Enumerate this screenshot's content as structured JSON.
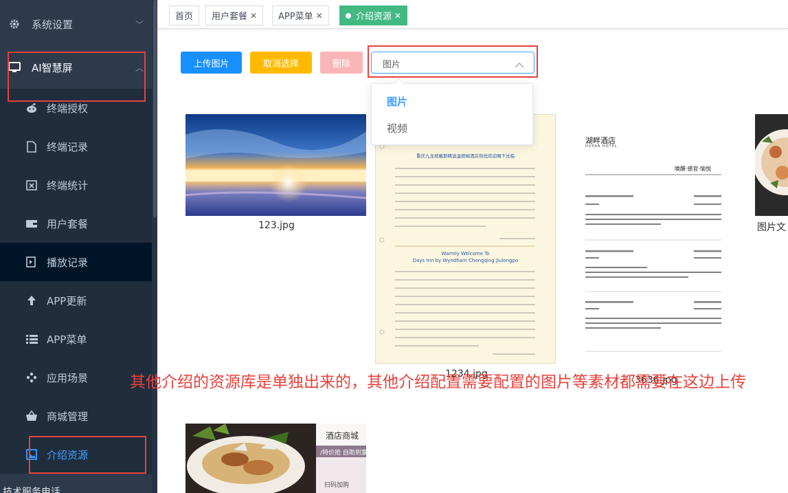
{
  "sidebar": {
    "items": [
      {
        "label": "系统设置",
        "icon": "gear-icon"
      },
      {
        "label": "AI智慧屏",
        "icon": "monitor-icon"
      },
      {
        "label": "终端授权",
        "icon": "robot-icon"
      },
      {
        "label": "终端记录",
        "icon": "document-icon"
      },
      {
        "label": "终端统计",
        "icon": "calendar-icon"
      },
      {
        "label": "用户套餐",
        "icon": "wallet-icon"
      },
      {
        "label": "播放记录",
        "icon": "video-record-icon"
      },
      {
        "label": "APP更新",
        "icon": "arrow-up-icon"
      },
      {
        "label": "APP菜单",
        "icon": "list-icon"
      },
      {
        "label": "应用场景",
        "icon": "pinwheel-icon"
      },
      {
        "label": "商城管理",
        "icon": "basket-icon"
      },
      {
        "label": "介绍资源",
        "icon": "picture-icon"
      }
    ],
    "bottom_label": "技术服务电话"
  },
  "tags": [
    {
      "label": "首页"
    },
    {
      "label": "用户套餐"
    },
    {
      "label": "APP菜单"
    },
    {
      "label": "介绍资源"
    }
  ],
  "toolbar": {
    "upload_label": "上传图片",
    "cancel_label": "取消选择",
    "delete_label": "删除",
    "type_select_value": "图片",
    "type_options": [
      "图片",
      "视频"
    ]
  },
  "gallery": [
    {
      "file": "123.jpg"
    },
    {
      "file": "1234.jpg"
    },
    {
      "file": "3636.jpg"
    },
    {
      "file": "图片文"
    },
    {
      "file": ""
    }
  ],
  "thumb_text": {
    "hotel_name": "湖畔酒店",
    "hotel_sub": "HUPAN HOTEL",
    "hotel_slogan": "唤醒·感官·愉悦",
    "letter_title": "重庆九龙坡戴斯精选温德姆酒店热忱欢迎阁下光临",
    "letter_en_1": "Warmly Welcome To",
    "letter_en_2": "Days Inn by Wyndham Chongqing Jiulongpo",
    "mall_title": "酒店商城",
    "mall_sub": "/特价抢 自助到家/",
    "mall_scan": "扫码加购"
  },
  "annotation": "其他介绍的资源库是单独出来的，其他介绍配置需要配置的图片等素材都需要在这边上传",
  "colors": {
    "sidebar_bg": "#2d3a4b",
    "active_text": "#409eff",
    "tag_active": "#42b983",
    "primary": "#1890ff",
    "warning": "#ffba00",
    "danger_disabled": "#fab6b6",
    "annotation": "#e8413a"
  }
}
